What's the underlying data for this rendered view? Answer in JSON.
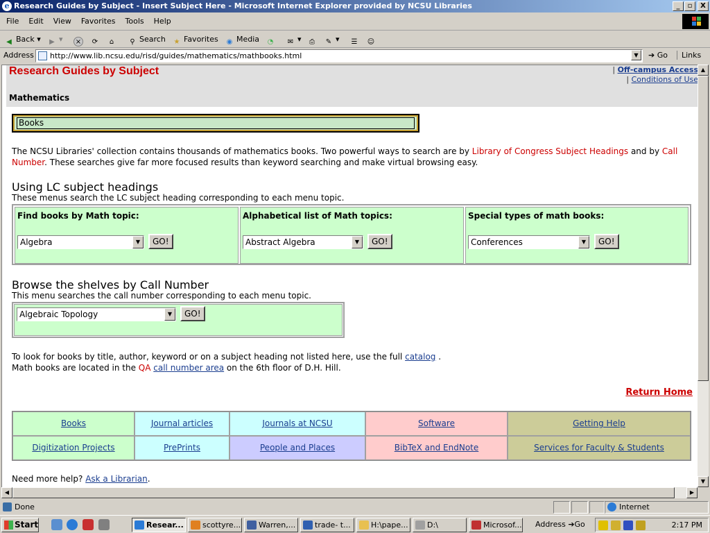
{
  "window": {
    "title": "Research Guides by Subject - Insert Subject Here - Microsoft Internet Explorer provided by NCSU Libraries",
    "minimize": "_",
    "maximize": "▫",
    "close": "X"
  },
  "menu": [
    "File",
    "Edit",
    "View",
    "Favorites",
    "Tools",
    "Help"
  ],
  "toolbar": {
    "back": "Back",
    "search": "Search",
    "favorites": "Favorites",
    "media": "Media"
  },
  "address": {
    "label": "Address",
    "url": "http://www.lib.ncsu.edu/risd/guides/mathematics/mathbooks.html",
    "go": "Go",
    "links": "Links"
  },
  "page": {
    "title": "Research Guides by Subject",
    "subject": "Mathematics",
    "offcampus": "Off-campus Access",
    "conditions": "Conditions of Use",
    "section_box": "Books",
    "intro": {
      "part1": "The NCSU Libraries' collection contains thousands of mathematics books. Two powerful ways to search are by ",
      "lcsh": "Library of Congress Subject Headings",
      "part2": " and by ",
      "callnum": "Call Number",
      "part3": ". These searches give far more focused results than keyword searching and make virtual browsing easy."
    },
    "lc_heading": "Using LC subject headings",
    "lc_desc": "These menus search the LC subject heading corresponding to each menu topic.",
    "lc_columns": [
      {
        "label": "Find books by Math topic:",
        "selected": "Algebra",
        "go": "GO!"
      },
      {
        "label": "Alphabetical list of Math topics:",
        "selected": "Abstract Algebra",
        "go": "GO!"
      },
      {
        "label": "Special types of math books:",
        "selected": "Conferences",
        "go": "GO!"
      }
    ],
    "cn_heading": "Browse the shelves by Call Number",
    "cn_desc": "This menu searches the call number corresponding to each menu topic.",
    "cn_selected": "Algebraic Topology",
    "cn_go": "GO!",
    "catalog_text": "To look for books by title, author, keyword or on a subject heading not listed here, use the full ",
    "catalog_link": "catalog",
    "catalog_end": " .",
    "location_text1": "Math books are located in the ",
    "location_qa": "QA",
    "location_link": "call number area",
    "location_text2": " on the 6th floor of D.H. Hill.",
    "return_home": "Return Home",
    "nav": [
      {
        "label": "Books",
        "color": "#ccffcc"
      },
      {
        "label": "Journal articles",
        "color": "#ccffff"
      },
      {
        "label": "Journals at NCSU",
        "color": "#ccffff"
      },
      {
        "label": "Software",
        "color": "#ffcccc"
      },
      {
        "label": "Getting Help",
        "color": "#cccc99"
      },
      {
        "label": "Digitization Projects",
        "color": "#ccffcc"
      },
      {
        "label": "PrePrints",
        "color": "#ccffff"
      },
      {
        "label": "People and Places",
        "color": "#ccccff"
      },
      {
        "label": "BibTeX and EndNote",
        "color": "#ffcccc"
      },
      {
        "label": "Services for Faculty & Students",
        "color": "#cccc99"
      }
    ],
    "help_text": "Need more help? ",
    "help_link": "Ask a Librarian",
    "help_end": "."
  },
  "status": {
    "text": "Done",
    "zone": "Internet"
  },
  "taskbar": {
    "start": "Start",
    "tasks": [
      "Resear...",
      "scottyre...",
      "Warren,...",
      "trade- t...",
      "H:\\pape...",
      "D:\\",
      "Microsof..."
    ],
    "address": "Address",
    "go": "Go",
    "clock": "2:17 PM"
  }
}
